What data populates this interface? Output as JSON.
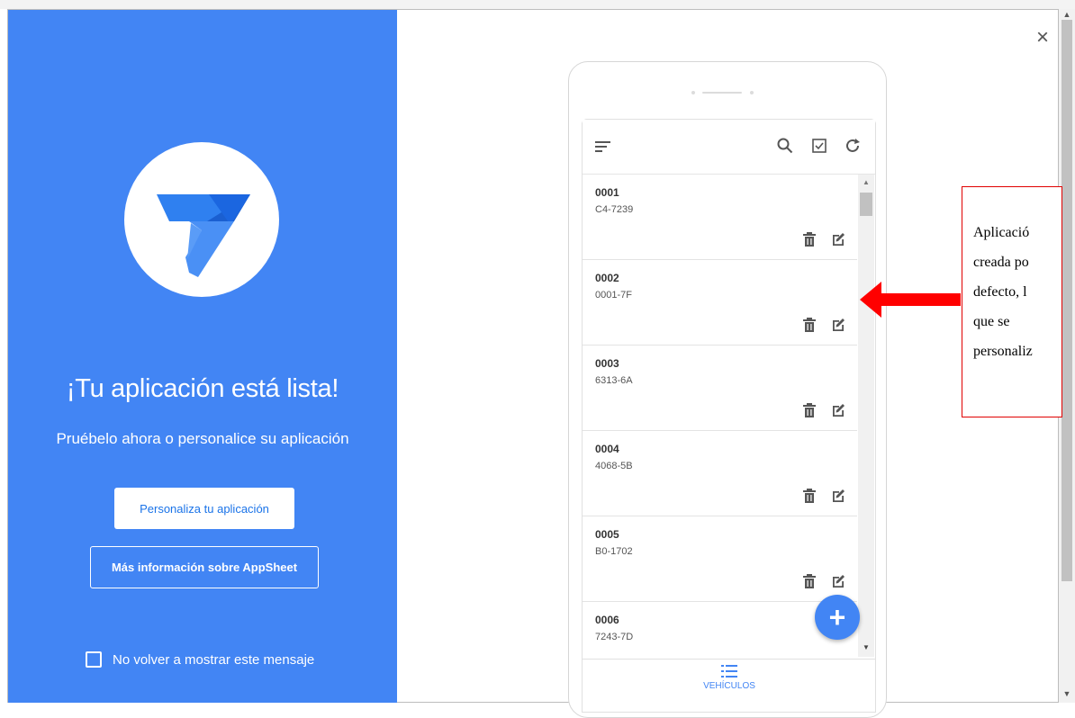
{
  "dialog": {
    "headline": "¡Tu aplicación está lista!",
    "subtitle": "Pruébelo ahora o personalice su aplicación",
    "customize_button": "Personaliza tu aplicación",
    "more_info_button": "Más información sobre AppSheet",
    "dont_show_label": "No volver a mostrar este mensaje",
    "close_label": "×",
    "brand_color": "#4285f4"
  },
  "app_preview": {
    "items": [
      {
        "id": "0001",
        "plate": "C4-7239"
      },
      {
        "id": "0002",
        "plate": "0001-7F"
      },
      {
        "id": "0003",
        "plate": "6313-6A"
      },
      {
        "id": "0004",
        "plate": "4068-5B"
      },
      {
        "id": "0005",
        "plate": "B0-1702"
      },
      {
        "id": "0006",
        "plate": "7243-7D"
      }
    ],
    "fab_label": "+",
    "nav_label": "VEHÍCULOS"
  },
  "annotation": {
    "lines": [
      "Aplicació",
      "creada po",
      "defecto, l",
      "que se",
      "personaliz"
    ],
    "border_color": "#e00000",
    "arrow_color": "#ff0000"
  }
}
